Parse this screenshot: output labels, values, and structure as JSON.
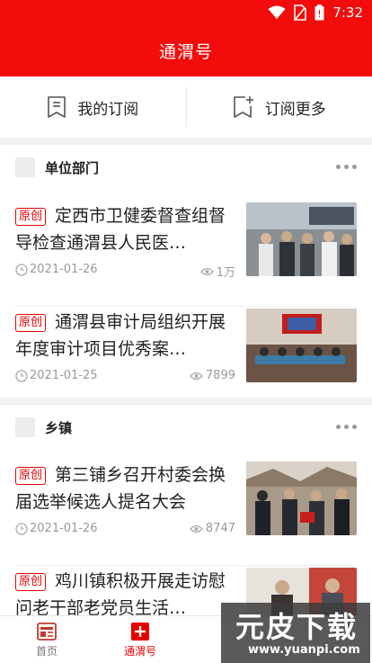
{
  "status_bar": {
    "time": "7:32",
    "icons": [
      "wifi-icon",
      "no-sim-icon",
      "battery-icon"
    ]
  },
  "header": {
    "title": "通渭号"
  },
  "subscription_bar": {
    "my_subscriptions": "我的订阅",
    "subscribe_more": "订阅更多"
  },
  "sections": [
    {
      "name": "单位部门",
      "articles": [
        {
          "badge": "原创",
          "title": "定西市卫健委督查组督导检查通渭县人民医…",
          "date": "2021-01-26",
          "views": "1万"
        },
        {
          "badge": "原创",
          "title": "通渭县审计局组织开展年度审计项目优秀案…",
          "date": "2021-01-25",
          "views": "7899"
        }
      ]
    },
    {
      "name": "乡镇",
      "articles": [
        {
          "badge": "原创",
          "title": "第三铺乡召开村委会换届选举候选人提名大会",
          "date": "2021-01-26",
          "views": "8747"
        },
        {
          "badge": "原创",
          "title": "鸡川镇积极开展走访慰问老干部老党员生活…",
          "date": "",
          "views": ""
        }
      ]
    }
  ],
  "tab_bar": {
    "tabs": [
      {
        "label": "首页",
        "icon": "news-icon",
        "active": false
      },
      {
        "label": "通渭号",
        "icon": "plus-square-icon",
        "active": true
      }
    ]
  },
  "watermark": {
    "text": "元皮下载",
    "url": "www.yuanpi.com"
  },
  "colors": {
    "brand_red": "#f20c0c",
    "accent_red": "#e60000"
  }
}
